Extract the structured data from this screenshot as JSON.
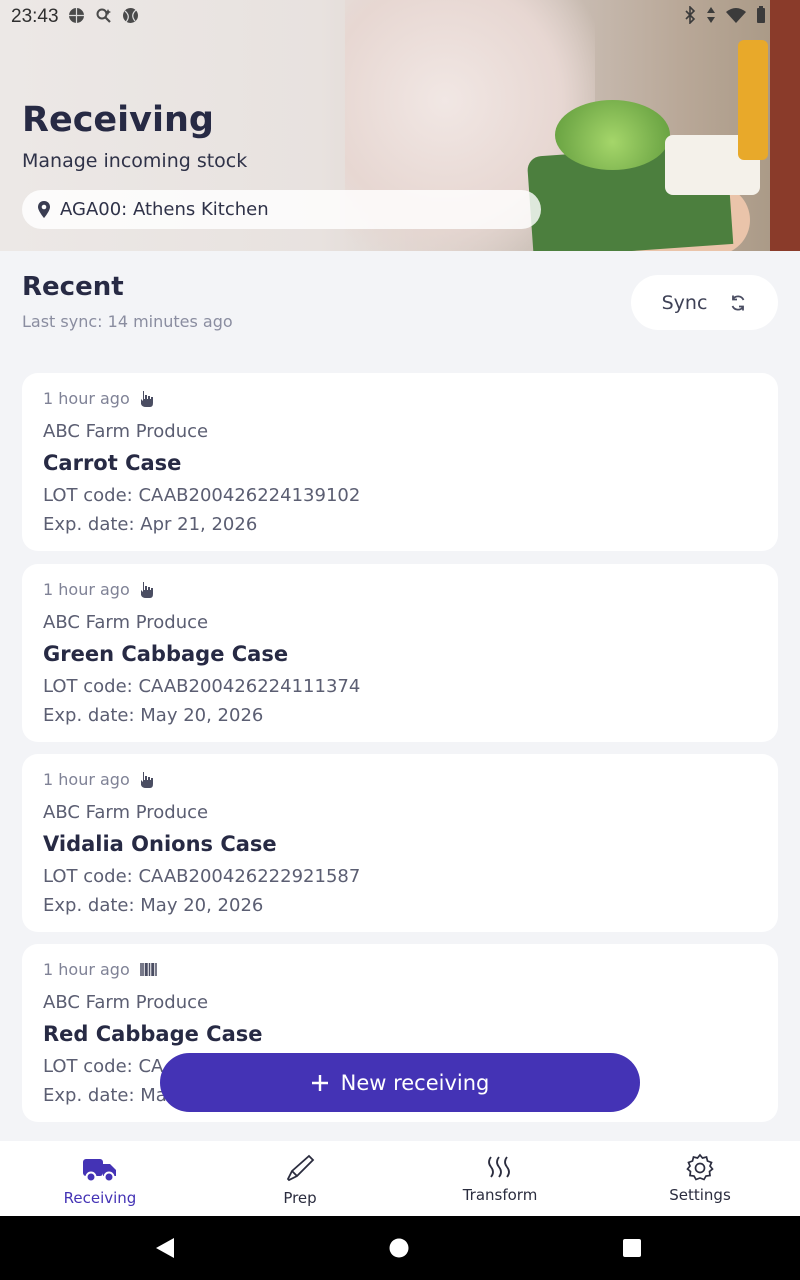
{
  "status_bar": {
    "time": "23:43"
  },
  "header": {
    "title": "Receiving",
    "subtitle": "Manage incoming stock",
    "location": "AGA00: Athens Kitchen"
  },
  "recent": {
    "title": "Recent",
    "last_sync": "Last sync: 14 minutes ago",
    "sync_label": "Sync",
    "cards": [
      {
        "time": "1 hour ago",
        "source_icon": "hand-pointer-icon",
        "supplier": "ABC Farm Produce",
        "item": "Carrot Case",
        "lot": "LOT code: CAAB200426224139102",
        "exp": "Exp. date: Apr 21, 2026"
      },
      {
        "time": "1 hour ago",
        "source_icon": "hand-pointer-icon",
        "supplier": "ABC Farm Produce",
        "item": "Green Cabbage Case",
        "lot": "LOT code: CAAB200426224111374",
        "exp": "Exp. date: May 20, 2026"
      },
      {
        "time": "1 hour ago",
        "source_icon": "hand-pointer-icon",
        "supplier": "ABC Farm Produce",
        "item": "Vidalia Onions Case",
        "lot": "LOT code: CAAB200426222921587",
        "exp": "Exp. date: May 20, 2026"
      },
      {
        "time": "1 hour ago",
        "source_icon": "barcode-icon",
        "supplier": "ABC Farm Produce",
        "item": "Red Cabbage Case",
        "lot": "LOT code: CA",
        "exp": "Exp. date: Ma"
      }
    ]
  },
  "fab": {
    "label": "New receiving"
  },
  "nav": [
    {
      "label": "Receiving",
      "icon": "truck-icon",
      "active": true
    },
    {
      "label": "Prep",
      "icon": "knife-icon",
      "active": false
    },
    {
      "label": "Transform",
      "icon": "steam-icon",
      "active": false
    },
    {
      "label": "Settings",
      "icon": "gear-icon",
      "active": false
    }
  ],
  "colors": {
    "accent": "#4433b5",
    "text": "#272a44",
    "muted": "#7f8296",
    "background": "#f3f4f7"
  }
}
